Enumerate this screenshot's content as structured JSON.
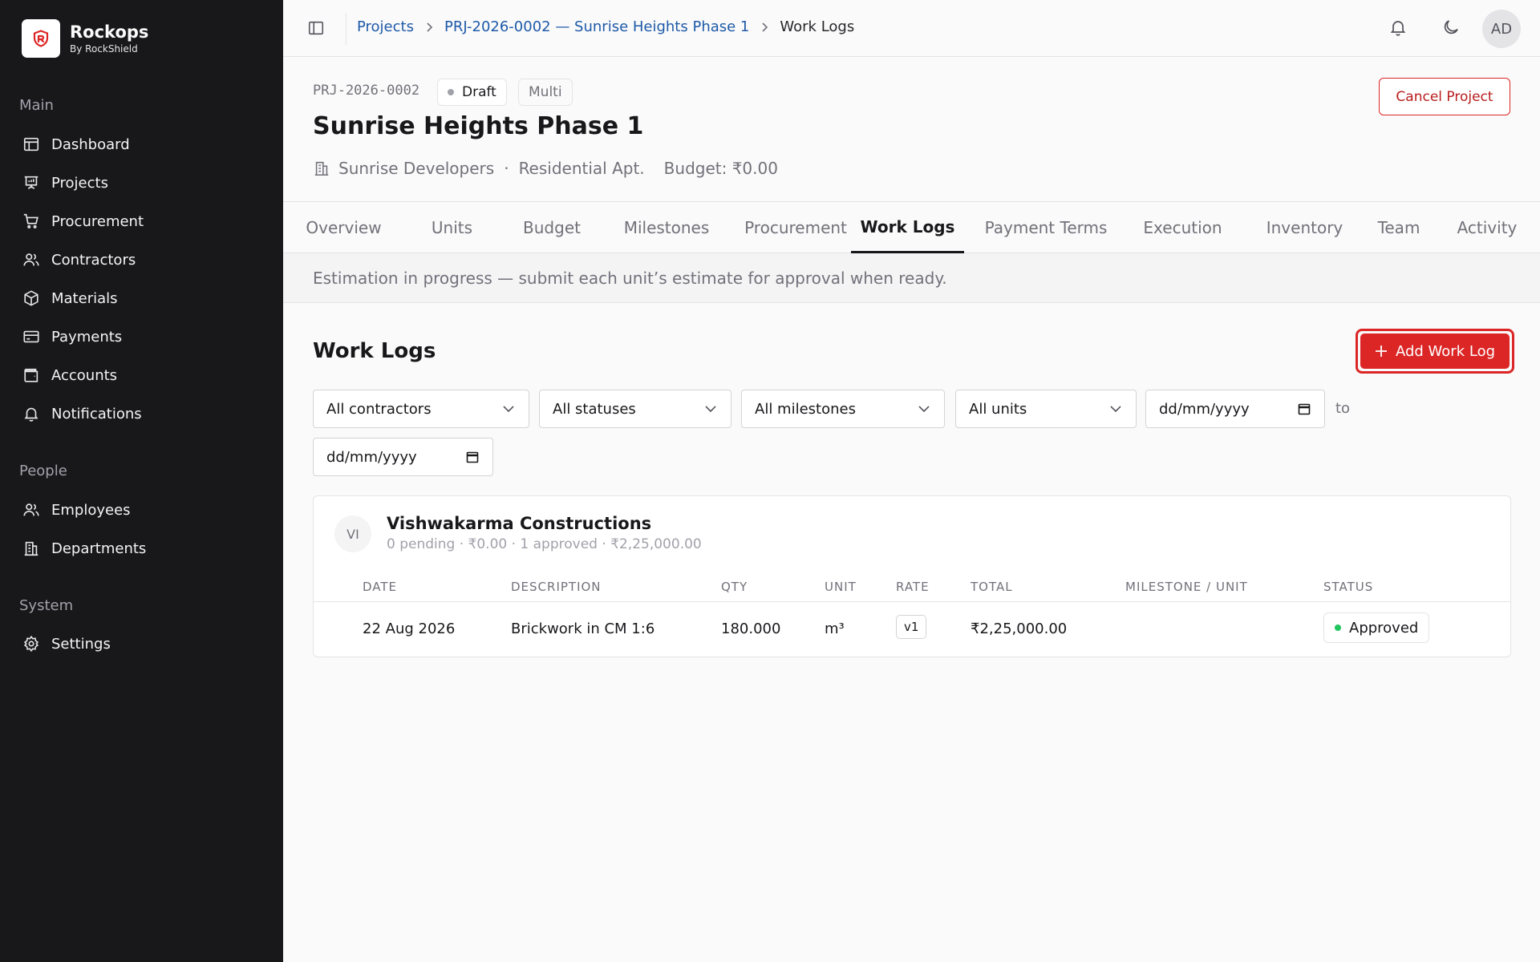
{
  "brand": {
    "name": "Rockops",
    "sub": "By RockShield"
  },
  "sidebar": {
    "sections": [
      {
        "label": "Main",
        "items": [
          {
            "label": "Dashboard",
            "icon": "dashboard-icon"
          },
          {
            "label": "Projects",
            "icon": "projects-icon"
          },
          {
            "label": "Procurement",
            "icon": "cart-icon"
          },
          {
            "label": "Contractors",
            "icon": "users-icon"
          },
          {
            "label": "Materials",
            "icon": "box-icon"
          },
          {
            "label": "Payments",
            "icon": "card-icon"
          },
          {
            "label": "Accounts",
            "icon": "wallet-icon"
          },
          {
            "label": "Notifications",
            "icon": "bell-icon"
          }
        ]
      },
      {
        "label": "People",
        "items": [
          {
            "label": "Employees",
            "icon": "users-icon"
          },
          {
            "label": "Departments",
            "icon": "building-icon"
          }
        ]
      },
      {
        "label": "System",
        "items": [
          {
            "label": "Settings",
            "icon": "gear-icon"
          }
        ]
      }
    ]
  },
  "breadcrumb": {
    "items": [
      "Projects",
      "PRJ-2026-0002 — Sunrise Heights Phase 1",
      "Work Logs"
    ]
  },
  "header": {
    "avatar_initials": "AD"
  },
  "project": {
    "code": "PRJ-2026-0002",
    "status": "Draft",
    "type_badge": "Multi",
    "title": "Sunrise Heights Phase 1",
    "client": "Sunrise Developers",
    "separator": "·",
    "category": "Residential Apt.",
    "budget": "Budget: ₹0.00",
    "cancel_label": "Cancel Project"
  },
  "tabs": {
    "items": [
      "Overview",
      "Units",
      "Budget",
      "Milestones",
      "Procurement",
      "Work Logs",
      "Payment Terms",
      "Execution",
      "Inventory",
      "Team",
      "Activity"
    ],
    "active": "Work Logs"
  },
  "banner": {
    "text": "Estimation in progress — submit each unit’s estimate for approval when ready."
  },
  "worklogs": {
    "title": "Work Logs",
    "add_label": "Add Work Log",
    "filters": {
      "contractor": "All contractors",
      "status": "All statuses",
      "milestone": "All milestones",
      "unit": "All units",
      "date_from": "dd/mm/yyyy",
      "to_label": "to",
      "date_to": "dd/mm/yyyy"
    },
    "groups": [
      {
        "initials": "VI",
        "name": "Vishwakarma Constructions",
        "summary": "0 pending · ₹0.00 · 1 approved · ₹2,25,000.00",
        "columns": [
          "DATE",
          "DESCRIPTION",
          "QTY",
          "UNIT",
          "RATE",
          "TOTAL",
          "MILESTONE / UNIT",
          "STATUS"
        ],
        "rows": [
          {
            "date": "22 Aug 2026",
            "description": "Brickwork in CM 1:6",
            "qty": "180.000",
            "unit": "m³",
            "rate": "v1",
            "total": "₹2,25,000.00",
            "milestone_unit": "",
            "status": "Approved"
          }
        ]
      }
    ]
  },
  "colors": {
    "sidebar_bg": "#18181b",
    "accent_red": "#dc2626",
    "link_blue": "#1e5aa8",
    "approved_green": "#22c55e",
    "draft_gray": "#a1a1aa"
  }
}
